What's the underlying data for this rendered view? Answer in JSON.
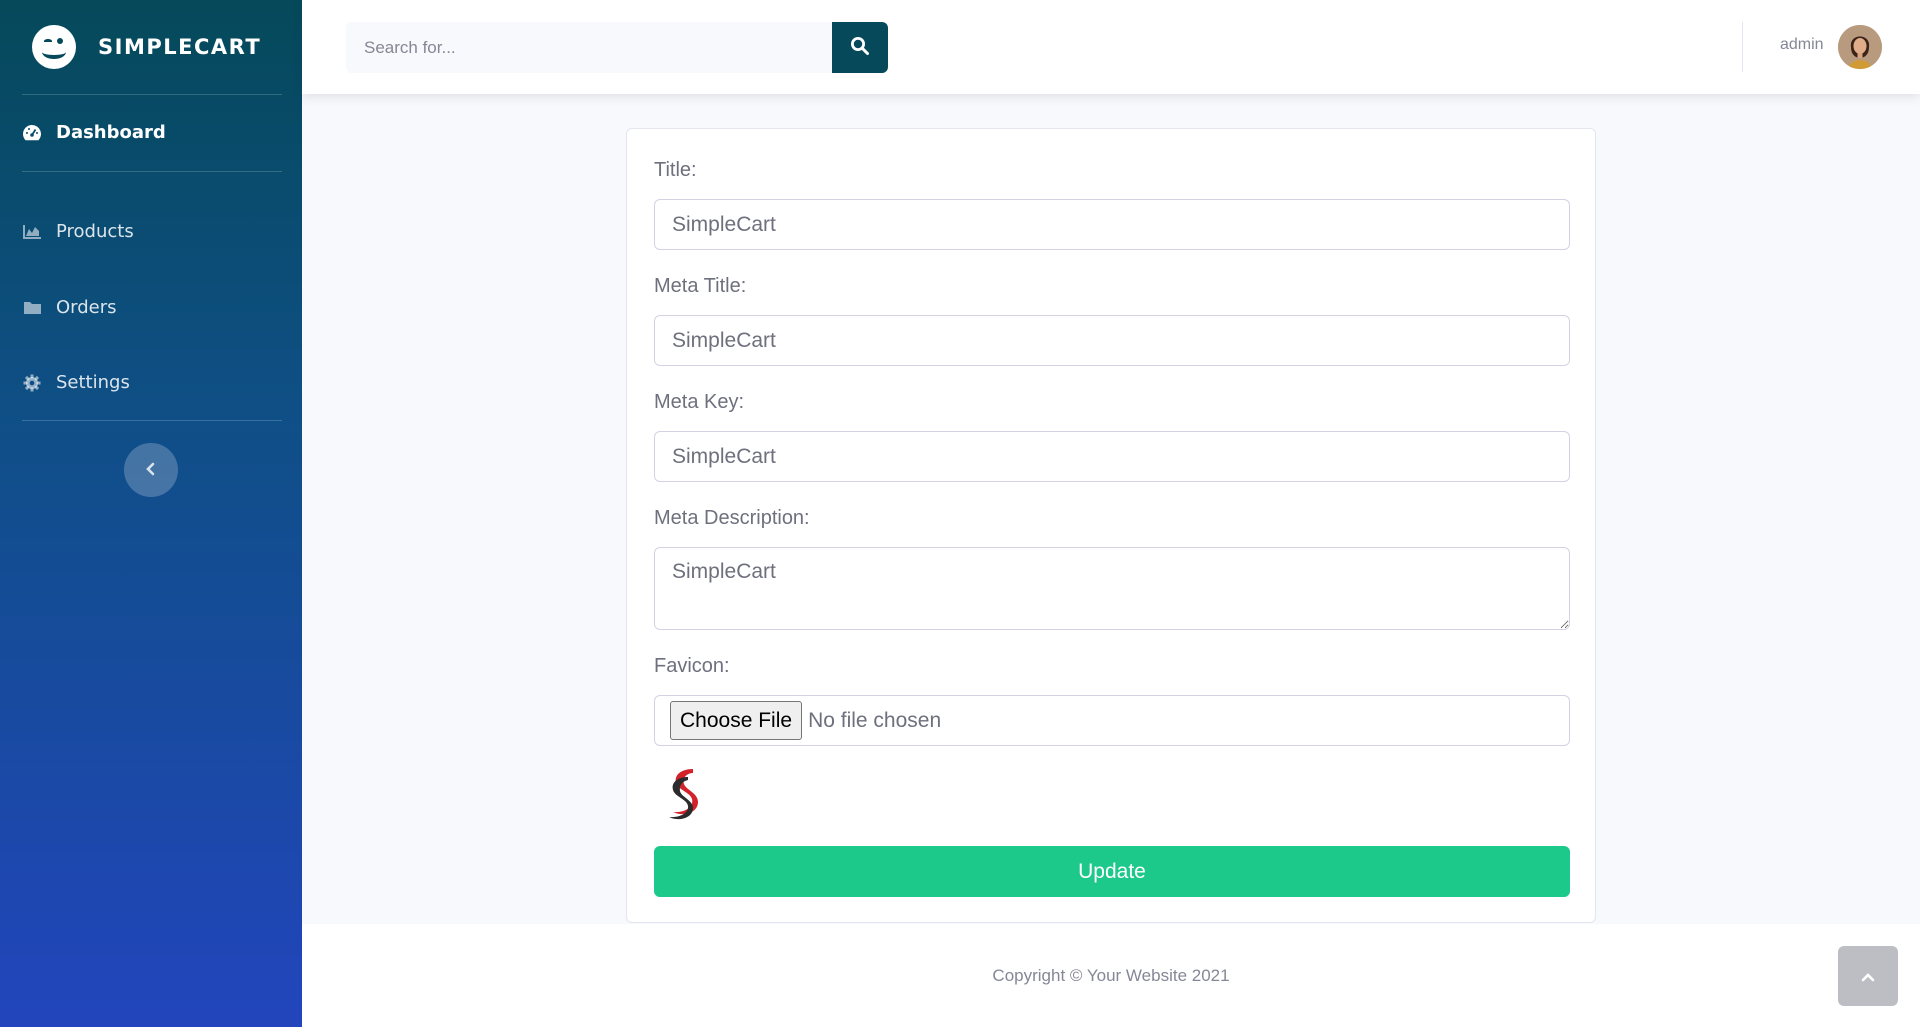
{
  "brand": {
    "name": "SIMPLECART",
    "logo_icon": "smile-wink-icon"
  },
  "sidebar": {
    "items": [
      {
        "label": "Dashboard",
        "icon": "tachometer-icon",
        "active": true
      },
      {
        "label": "Products",
        "icon": "chart-area-icon",
        "active": false
      },
      {
        "label": "Orders",
        "icon": "folder-icon",
        "active": false
      },
      {
        "label": "Settings",
        "icon": "gear-icon",
        "active": false
      }
    ],
    "toggle_icon": "chevron-left-icon"
  },
  "topbar": {
    "search_placeholder": "Search for...",
    "search_icon": "search-icon",
    "user_name": "admin"
  },
  "form": {
    "title_label": "Title:",
    "title_value": "SimpleCart",
    "meta_title_label": "Meta Title:",
    "meta_title_value": "SimpleCart",
    "meta_key_label": "Meta Key:",
    "meta_key_value": "SimpleCart",
    "meta_description_label": "Meta Description:",
    "meta_description_value": "SimpleCart",
    "favicon_label": "Favicon:",
    "choose_file_label": "Choose File",
    "file_status": "No file chosen",
    "update_label": "Update"
  },
  "footer": {
    "copyright": "Copyright © Your Website 2021"
  },
  "colors": {
    "sidebar_top": "#05495a",
    "sidebar_bottom": "#2245bd",
    "success": "#1cc88a"
  }
}
